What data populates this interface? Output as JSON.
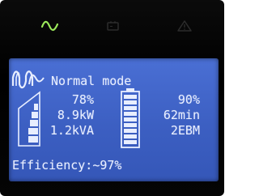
{
  "indicators": [
    {
      "name": "normal-mode",
      "icon": "sine-wave-icon",
      "color": "#9be85a"
    },
    {
      "name": "battery-mode",
      "icon": "battery-icon",
      "color": "#2a2a2a"
    },
    {
      "name": "fault",
      "icon": "warning-triangle-icon",
      "color": "#2a2a2a"
    }
  ],
  "screen": {
    "mode_label": "Normal mode",
    "mode_icon": "sine-wave-icon",
    "load": {
      "icon": "load-bar-icon",
      "percent": "78%",
      "power_kw": "8.9kW",
      "power_kva": "1.2kVA"
    },
    "battery": {
      "icon": "battery-level-icon",
      "percent": "90%",
      "runtime": "62min",
      "ebm": "2EBM"
    },
    "efficiency": "Efficiency:~97%",
    "background_color": "#3f63c6",
    "text_color": "#e8eeff"
  }
}
